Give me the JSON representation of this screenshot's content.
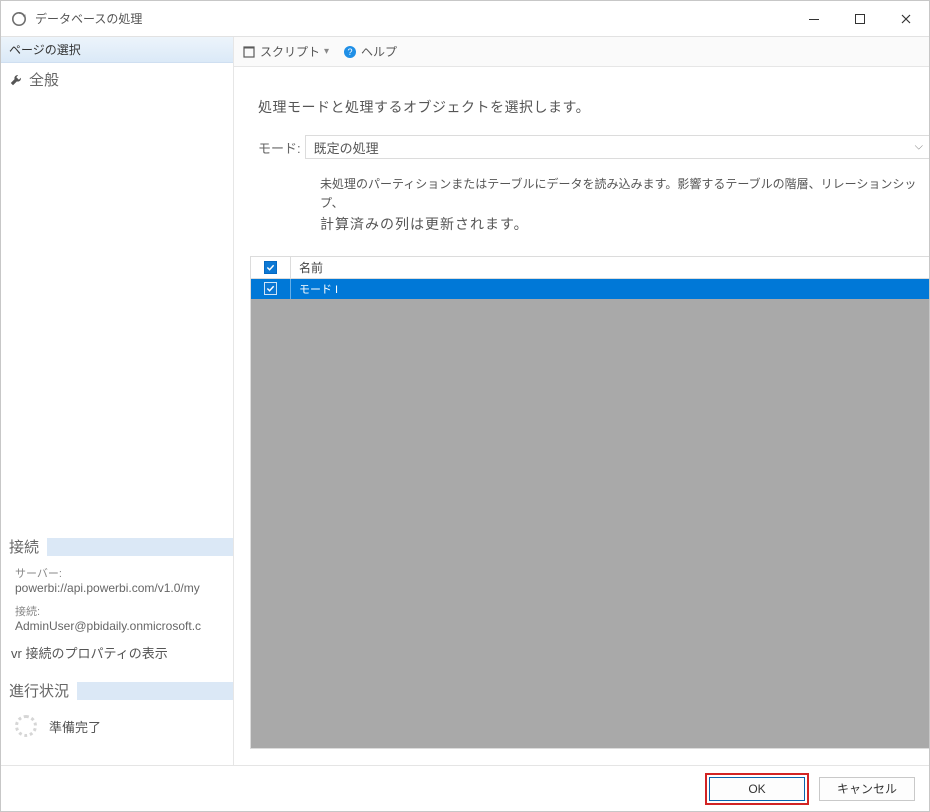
{
  "titlebar": {
    "title": "データベースの処理"
  },
  "sidebar": {
    "page_selection_header": "ページの選択",
    "pages": [
      {
        "label": "全般"
      }
    ],
    "connection": {
      "section_title": "接続",
      "server_label": "サーバー:",
      "server_value": "powerbi://api.powerbi.com/v1.0/my",
      "conn_label": "接続:",
      "conn_value": "AdminUser@pbidaily.onmicrosoft.c",
      "props_link_prefix": "vr",
      "props_link": "接続のプロパティの表示"
    },
    "progress": {
      "section_title": "進行状況",
      "status": "準備完了"
    }
  },
  "toolbar": {
    "script_label": "スクリプト",
    "help_label": "ヘルプ"
  },
  "main": {
    "description": "処理モードと処理するオブジェクトを選択します。",
    "mode_label": "モード:",
    "mode_value": "既定の処理",
    "mode_hint_line1": "未処理のパーティションまたはテーブルにデータを読み込みます。影響するテーブルの階層、リレーションシップ、",
    "mode_hint_line2": "計算済みの列は更新されます。",
    "table": {
      "header_name": "名前",
      "rows": [
        {
          "name": "モード I"
        }
      ]
    }
  },
  "footer": {
    "ok_label": "OK",
    "cancel_label": "キャンセル"
  }
}
